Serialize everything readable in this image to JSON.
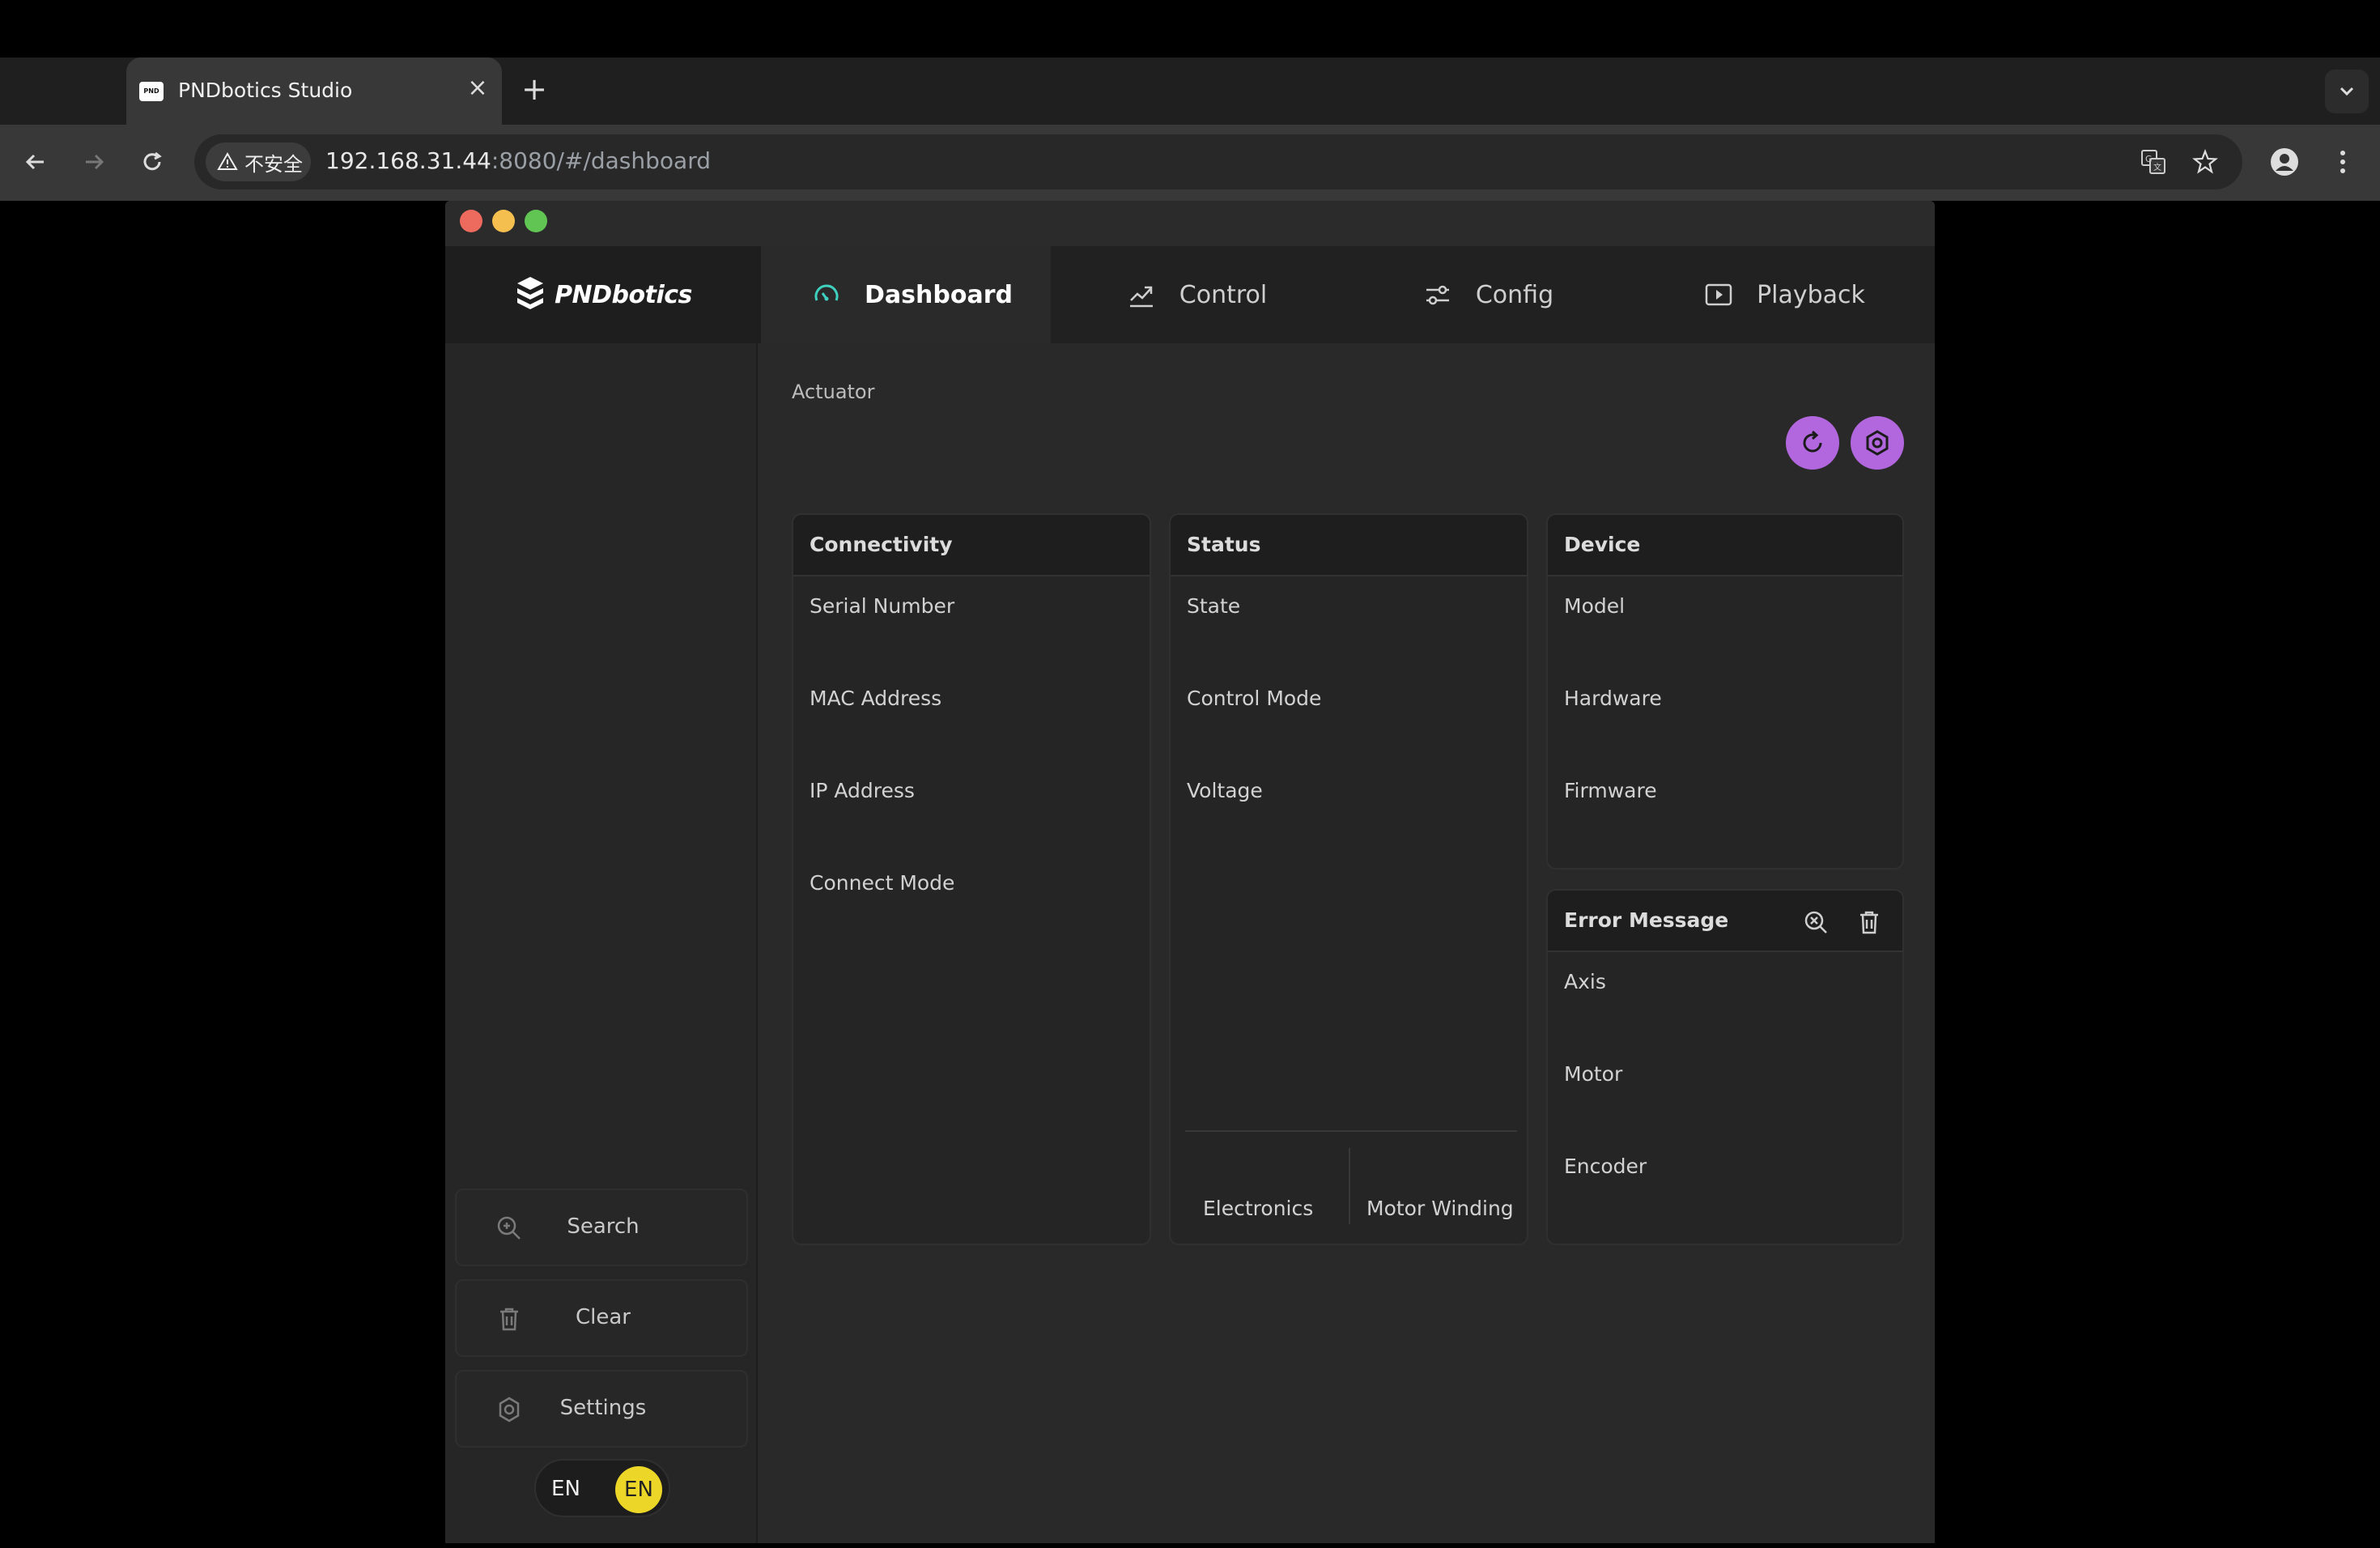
{
  "browser": {
    "tab_title": "PNDbotics Studio",
    "favicon_text": "PND",
    "url_host": "192.168.31.44",
    "url_rest": ":8080/#/dashboard",
    "security_label": "不安全"
  },
  "app": {
    "logo_text": "PNDbotics",
    "nav": [
      {
        "label": "Dashboard",
        "icon": "gauge-icon",
        "active": true
      },
      {
        "label": "Control",
        "icon": "trend-icon"
      },
      {
        "label": "Config",
        "icon": "sliders-icon"
      },
      {
        "label": "Playback",
        "icon": "play-icon"
      }
    ],
    "sidebar": {
      "search_label": "Search",
      "clear_label": "Clear",
      "settings_label": "Settings",
      "lang_left": "EN",
      "lang_right": "EN"
    },
    "section_title": "Actuator",
    "cards": {
      "connectivity": {
        "title": "Connectivity",
        "rows": [
          "Serial Number",
          "MAC Address",
          "IP Address",
          "Connect Mode"
        ]
      },
      "status": {
        "title": "Status",
        "rows": [
          "State",
          "Control Mode",
          "Voltage"
        ],
        "footer": [
          "Electronics",
          "Motor Winding"
        ]
      },
      "device": {
        "title": "Device",
        "rows": [
          "Model",
          "Hardware",
          "Firmware"
        ]
      },
      "error": {
        "title": "Error Message",
        "rows": [
          "Axis",
          "Motor",
          "Encoder"
        ]
      }
    },
    "colors": {
      "accent_purple": "#b267df",
      "lang_active": "#ecd728",
      "dashboard_icon": "#3fd0c0"
    }
  }
}
